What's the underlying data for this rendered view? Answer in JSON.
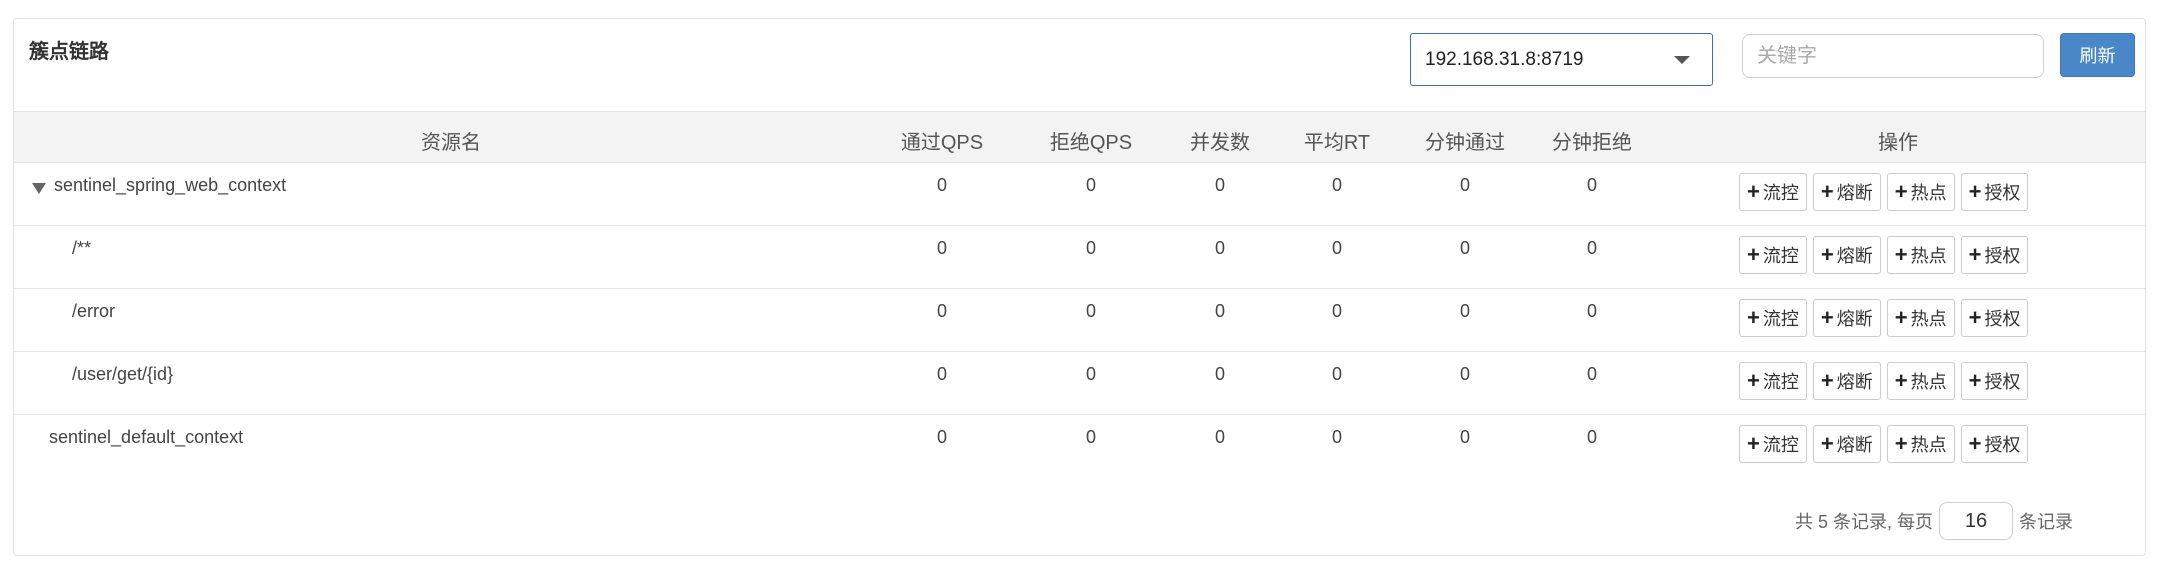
{
  "panel": {
    "title": "簇点链路",
    "machine_select": {
      "value": "192.168.31.8:8719"
    },
    "search": {
      "placeholder": "关键字"
    },
    "refresh_label": "刷新"
  },
  "table": {
    "headers": {
      "resource": "资源名",
      "pass_qps": "通过QPS",
      "block_qps": "拒绝QPS",
      "concurrency": "并发数",
      "avg_rt": "平均RT",
      "minute_pass": "分钟通过",
      "minute_block": "分钟拒绝",
      "actions": "操作"
    },
    "action_labels": {
      "flow": "流控",
      "degrade": "熔断",
      "hotspot": "热点",
      "auth": "授权"
    },
    "rows": [
      {
        "name": "sentinel_spring_web_context",
        "pass_qps": "0",
        "block_qps": "0",
        "concurrency": "0",
        "avg_rt": "0",
        "minute_pass": "0",
        "minute_block": "0"
      },
      {
        "name": "/**",
        "pass_qps": "0",
        "block_qps": "0",
        "concurrency": "0",
        "avg_rt": "0",
        "minute_pass": "0",
        "minute_block": "0"
      },
      {
        "name": "/error",
        "pass_qps": "0",
        "block_qps": "0",
        "concurrency": "0",
        "avg_rt": "0",
        "minute_pass": "0",
        "minute_block": "0"
      },
      {
        "name": "/user/get/{id}",
        "pass_qps": "0",
        "block_qps": "0",
        "concurrency": "0",
        "avg_rt": "0",
        "minute_pass": "0",
        "minute_block": "0"
      },
      {
        "name": "sentinel_default_context",
        "pass_qps": "0",
        "block_qps": "0",
        "concurrency": "0",
        "avg_rt": "0",
        "minute_pass": "0",
        "minute_block": "0"
      }
    ]
  },
  "pagination": {
    "total_text": "共 5 条记录, 每页",
    "page_size": "16",
    "suffix_text": "条记录"
  },
  "colors": {
    "primary": "#4a87c9",
    "header_bg": "#f3f3f3",
    "border": "#e3e3e3"
  }
}
